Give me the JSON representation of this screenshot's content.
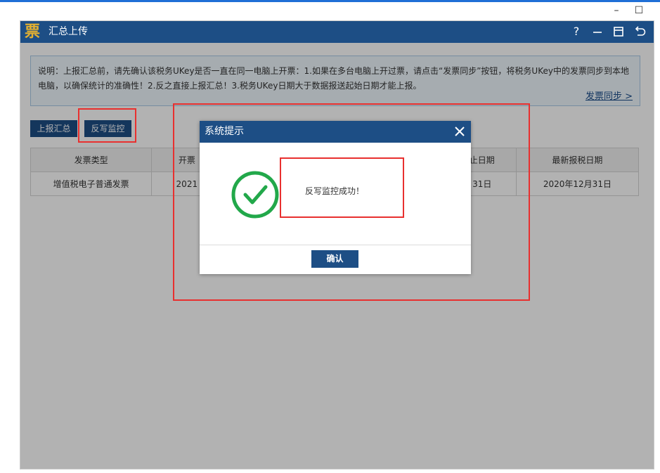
{
  "os": {
    "min_label": "–",
    "max_label": "☐"
  },
  "app": {
    "logo": "票",
    "title": "汇总上传",
    "help_label": "?"
  },
  "notice": {
    "text": "说明：上报汇总前，请先确认该税务UKey是否一直在同一电脑上开票：1.如果在多台电脑上开过票，请点击“发票同步”按钮，将税务UKey中的发票同步到本地电脑，以确保统计的准确性！2.反之直接上报汇总！3.税务UKey日期大于数据报送起始日期才能上报。",
    "sync_link": "发票同步 >"
  },
  "toolbar": {
    "report_summary": "上报汇总",
    "write_back_monitor": "反写监控"
  },
  "table": {
    "headers": [
      "发票类型",
      "开票",
      "",
      "",
      "止日期",
      "最新报税日期"
    ],
    "rows": [
      [
        "增值税电子普通发票",
        "2021",
        "",
        "",
        "31日",
        "2020年12月31日"
      ]
    ]
  },
  "dialog": {
    "title": "系统提示",
    "message": "反写监控成功！",
    "confirm_label": "确认"
  },
  "colors": {
    "title_bar": "#1d4e85",
    "logo": "#e5b130",
    "success_green": "#22a84a",
    "annotation_red": "#e8302f"
  }
}
